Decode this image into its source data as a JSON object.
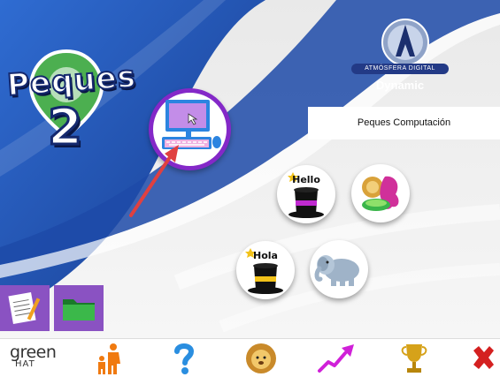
{
  "app": {
    "logo_word": "Peques",
    "logo_number": "2"
  },
  "brand": {
    "name": "ATMÓSFERA DIGITAL",
    "subtitle": "Dynamic"
  },
  "section": {
    "title": "Peques Computación"
  },
  "activities": [
    {
      "icon": "computer-icon",
      "selected": true
    },
    {
      "icon": "hat-hello-icon",
      "label": "Hello"
    },
    {
      "icon": "animals-icon"
    },
    {
      "icon": "hat-hola-icon",
      "label": "Hola"
    },
    {
      "icon": "elephant-icon"
    }
  ],
  "sidebar": [
    {
      "icon": "notebook-icon"
    },
    {
      "icon": "folder-icon"
    }
  ],
  "toolbar": {
    "brand_top": "green",
    "brand_bottom": "HAT",
    "items": [
      {
        "icon": "parent-child-icon"
      },
      {
        "icon": "help-icon"
      },
      {
        "icon": "lion-icon"
      },
      {
        "icon": "progress-chart-icon"
      },
      {
        "icon": "trophy-icon"
      },
      {
        "icon": "close-icon"
      }
    ]
  },
  "colors": {
    "accent_purple": "#8428c8",
    "dark_blue": "#14286e",
    "arrow_red": "#e04040",
    "close_red": "#d42020",
    "progress_magenta": "#d020d8",
    "help_blue": "#2a8ee0",
    "person_orange": "#f07a10"
  }
}
